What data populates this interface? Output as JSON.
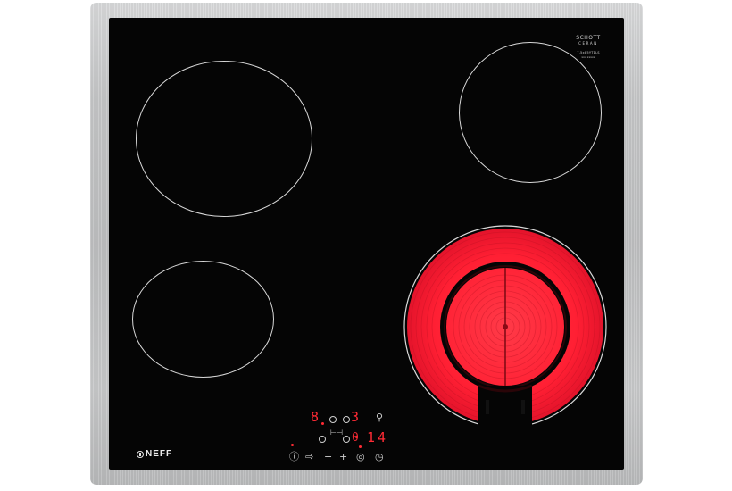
{
  "product": {
    "brand": "NEFF",
    "glass_brand_line1": "SCHOTT",
    "glass_brand_line2": "CERAN",
    "glass_brand_code1": "7.5x85YT1LS",
    "glass_brand_code2": "xxx xxxxx"
  },
  "colors": {
    "frame": "#c4c5c6",
    "glass": "#050505",
    "heating": "#ff2236",
    "display": "#ff2b35"
  },
  "zones": [
    {
      "name": "rear-left",
      "state": "off"
    },
    {
      "name": "rear-right",
      "state": "off"
    },
    {
      "name": "front-left",
      "state": "off"
    },
    {
      "name": "front-right-dual",
      "state": "on"
    }
  ],
  "controls": {
    "power_level": "8",
    "zone_select_display": "3",
    "timer_display": "14",
    "timer_prefix": "0",
    "symbols": {
      "power": "power-icon",
      "select": "arrow-right-icon",
      "minus": "minus-icon",
      "plus": "plus-icon",
      "lock": "lock-icon",
      "timer": "clock-icon"
    }
  }
}
